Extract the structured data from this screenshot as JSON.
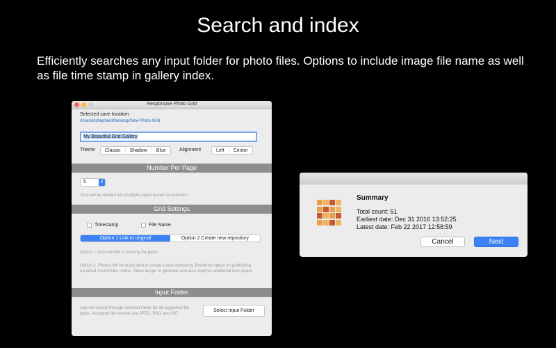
{
  "hero": {
    "title": "Search and index",
    "description": "Efficiently searches any input folder for photo files. Options to include image file name as well as file time stamp in gallery index."
  },
  "window": {
    "title": "Responsive Photo Grid",
    "save_label": "Selected save location:",
    "save_path": "/Users/dshepherd/Desktop/New Photo Grid",
    "gallery_title_value": "My Beautiful Grid Gallery",
    "theme_label": "Theme",
    "theme_options": [
      "Classic",
      "Shadow",
      "Blue"
    ],
    "alignment_label": "Alignment",
    "alignment_options": [
      "Left",
      "Center"
    ],
    "number_per_page_header": "Number Per Page",
    "per_page_value": "5",
    "per_page_hint": "Total will be divided into multiple pages based on selection",
    "grid_settings_header": "Grid Settings",
    "timestamp_label": "Timestamp",
    "filename_label": "File Name",
    "option1_label": "Option 1 Link to original",
    "option2_label": "Option 2 Create new repository",
    "option1_desc": "Option 1. Grid will link to existing file paths",
    "option2_desc": "Option 2. Photos will be duplicated to create a new repository. Preferred option for publishing exported source files online.  Takes longer to generate and also requires additional disk space.",
    "input_folder_header": "Input Folder",
    "input_folder_desc": "App will search through selected folder for all supported file types.  Accepted file formats are JPEG, PNG and GIF.",
    "select_input_folder_label": "Select Input Folder"
  },
  "summary": {
    "title": "Summary",
    "total_count": "Total count: 51",
    "earliest_date": "Earliest date: Dec 31 2016 13:52:25",
    "latest_date": "Latest date: Feb 22 2017 12:58:59",
    "cancel_label": "Cancel",
    "next_label": "Next"
  },
  "colors": {
    "accent": "#3b82f6",
    "band": "#8d8d8d",
    "background": "#000000"
  }
}
